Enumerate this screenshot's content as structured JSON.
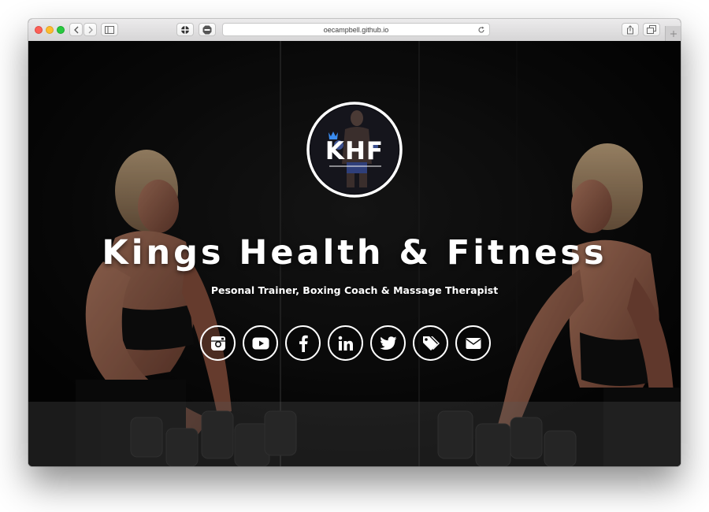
{
  "browser": {
    "url": "oecampbell.github.io"
  },
  "hero": {
    "logo_text": "KHF",
    "title": "Kings Health & Fitness",
    "subtitle": "Pesonal Trainer, Boxing Coach & Massage Therapist"
  },
  "social_links": [
    {
      "icon": "instagram-icon"
    },
    {
      "icon": "youtube-icon"
    },
    {
      "icon": "facebook-icon"
    },
    {
      "icon": "linkedin-icon"
    },
    {
      "icon": "twitter-icon"
    },
    {
      "icon": "tags-icon"
    },
    {
      "icon": "envelope-icon"
    }
  ],
  "colors": {
    "hero_background": "#0b0b0b",
    "text": "#ffffff",
    "logo_crown": "#3a8cf0"
  }
}
